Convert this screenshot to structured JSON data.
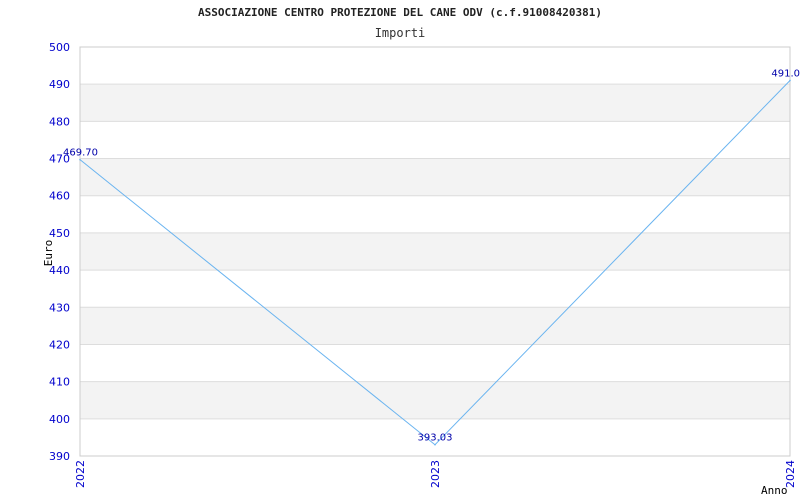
{
  "chart_data": {
    "type": "line",
    "title": "ASSOCIAZIONE CENTRO PROTEZIONE DEL CANE ODV (c.f.91008420381)",
    "subtitle": "Importi",
    "xlabel": "Anno",
    "ylabel": "Euro",
    "categories": [
      "2022",
      "2023",
      "2024"
    ],
    "series": [
      {
        "values": [
          469.7,
          393.03,
          491.0
        ],
        "labels": [
          "469.70",
          "393.03",
          "491.0"
        ]
      }
    ],
    "ylim": [
      390,
      500
    ],
    "yticks": [
      "390",
      "400",
      "410",
      "420",
      "430",
      "440",
      "450",
      "460",
      "470",
      "480",
      "490",
      "500"
    ],
    "grid": true,
    "band_color": "#f3f3f3",
    "line_color": "#6ab4f0",
    "tick_color": "#0000cc"
  }
}
